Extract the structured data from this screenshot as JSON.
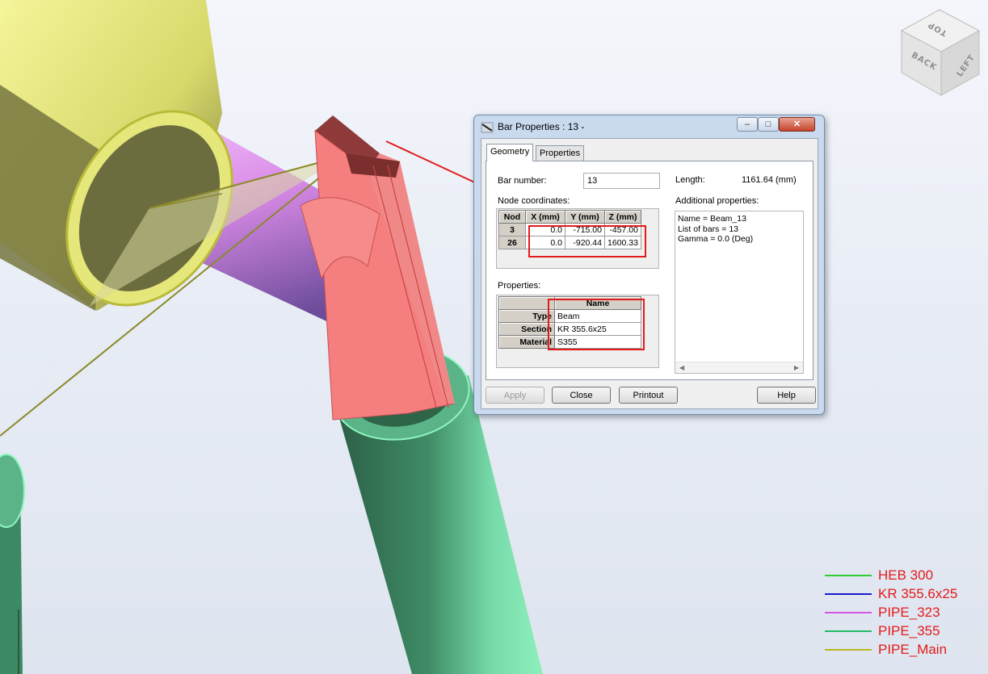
{
  "dialog": {
    "title": "Bar Properties : 13 -",
    "window_controls": {
      "minimize": "–",
      "maximize": "□",
      "close": "✕"
    },
    "tabs": [
      {
        "label": "Geometry",
        "active": true
      },
      {
        "label": "Properties",
        "active": false
      }
    ],
    "bar_number": {
      "label": "Bar number:",
      "value": "13"
    },
    "length": {
      "label": "Length:",
      "value": "1161.64 (mm)"
    },
    "node_coordinates": {
      "label": "Node coordinates:",
      "headers": [
        "Nod",
        "X (mm)",
        "Y (mm)",
        "Z (mm)"
      ],
      "rows": [
        {
          "nod": "3",
          "x": "0.0",
          "y": "-715.00",
          "z": "-457.00"
        },
        {
          "nod": "26",
          "x": "0.0",
          "y": "-920.44",
          "z": "1600.33"
        }
      ]
    },
    "additional_properties": {
      "label": "Additional properties:",
      "lines": [
        "Name = Beam_13",
        "List of bars = 13",
        "Gamma = 0.0 (Deg)"
      ]
    },
    "properties": {
      "label": "Properties:",
      "header": "Name",
      "rows": [
        {
          "key": "Type",
          "value": "Beam"
        },
        {
          "key": "Section",
          "value": "KR 355.6x25"
        },
        {
          "key": "Material",
          "value": "S355"
        }
      ]
    },
    "buttons": {
      "apply": "Apply",
      "close": "Close",
      "printout": "Printout",
      "help": "Help"
    }
  },
  "viewcube": {
    "top": "TOP",
    "back": "BACK",
    "left": "LEFT"
  },
  "legend": [
    {
      "label": "HEB 300",
      "color": "#33cc33"
    },
    {
      "label": "KR 355.6x25",
      "color": "#1a1acc"
    },
    {
      "label": "PIPE_323",
      "color": "#d455e0"
    },
    {
      "label": "PIPE_355",
      "color": "#22bb66"
    },
    {
      "label": "PIPE_Main",
      "color": "#b8b822"
    }
  ],
  "colors": {
    "accent_red": "#e21b1b",
    "pipe_main": "#f2f28a",
    "pipe_323": "#e8a6f2",
    "pipe_355": "#7ce6b2",
    "plate": "#f57f7f"
  }
}
